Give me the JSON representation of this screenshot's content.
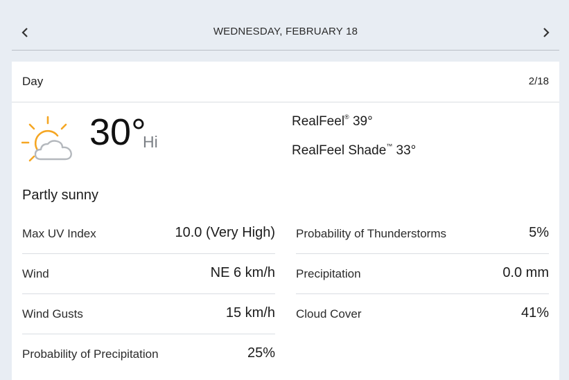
{
  "header": {
    "date_title": "WEDNESDAY, FEBRUARY 18",
    "prev_icon": "chevron-left-icon",
    "next_icon": "chevron-right-icon"
  },
  "card": {
    "period": "Day",
    "short_date": "2/18",
    "icon": "partly-sunny-icon",
    "temperature": "30°",
    "temperature_label": "Hi",
    "realfeel_label": "RealFeel",
    "realfeel_mark": "®",
    "realfeel_value": "39°",
    "realfeel_shade_label": "RealFeel Shade",
    "realfeel_shade_mark": "™",
    "realfeel_shade_value": "33°",
    "phrase": "Partly sunny"
  },
  "details_left": [
    {
      "label": "Max UV Index",
      "value": "10.0 (Very High)"
    },
    {
      "label": "Wind",
      "value": "NE 6 km/h"
    },
    {
      "label": "Wind Gusts",
      "value": "15 km/h"
    },
    {
      "label": "Probability of Precipitation",
      "value": "25%"
    }
  ],
  "details_right": [
    {
      "label": "Probability of Thunderstorms",
      "value": "5%"
    },
    {
      "label": "Precipitation",
      "value": "0.0 mm"
    },
    {
      "label": "Cloud Cover",
      "value": "41%"
    }
  ],
  "colors": {
    "sun": "#f5a623",
    "cloud": "#b4b8bd",
    "page_background": "#e8edf3"
  }
}
